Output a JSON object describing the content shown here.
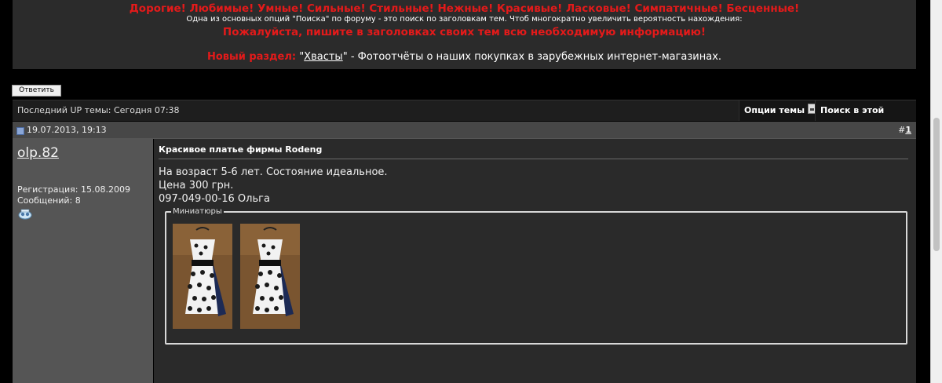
{
  "notice": {
    "line1": "Дорогие! Любимые! Умные! Сильные! Стильные! Нежные! Красивые! Ласковые! Симпатичные! Бесценные!",
    "line2": "Одна из основных опций \"Поиска\" по форуму - это поиск по заголовкам тем. Чтоб многократно увеличить вероятность нахождения:",
    "line3": "Пожалуйста, пишите в заголовках своих тем всю необходимую информацию!",
    "new_section_label": "Новый раздел:",
    "quote_open": "\"",
    "link_text": "Хвасты",
    "quote_close_desc": "\" - Фотоотчёты о наших покупках в зарубежных интернет-магазинах."
  },
  "reply_button": "Ответить",
  "thread_bar": {
    "last_up": "Последний UP темы: Сегодня 07:38",
    "options": "Опции темы",
    "search": "Поиск в этой теме"
  },
  "post": {
    "date": "19.07.2013, 19:13",
    "number_prefix": "#",
    "number": "1",
    "username": "olp.82",
    "registration": "Регистрация: 15.08.2009",
    "messages": "Сообщений: 8",
    "title": "Красивое платье фирмы Rodeng",
    "lines": [
      "На возраст 5-6 лет. Состояние идеальное.",
      "Цена 300 грн.",
      "097-049-00-16 Ольга"
    ],
    "thumbs_legend": "Миниатюры",
    "thumbnails": [
      "dress-photo-1",
      "dress-photo-2"
    ]
  },
  "colors": {
    "accent_red": "#e41a1a",
    "panel": "#2b2b2b",
    "user_column": "#555555",
    "post_body": "#2a2a2a"
  },
  "icons": {
    "post": "post-status-icon",
    "tool": "dropdown-menu-icon",
    "message": "send-message-icon"
  }
}
